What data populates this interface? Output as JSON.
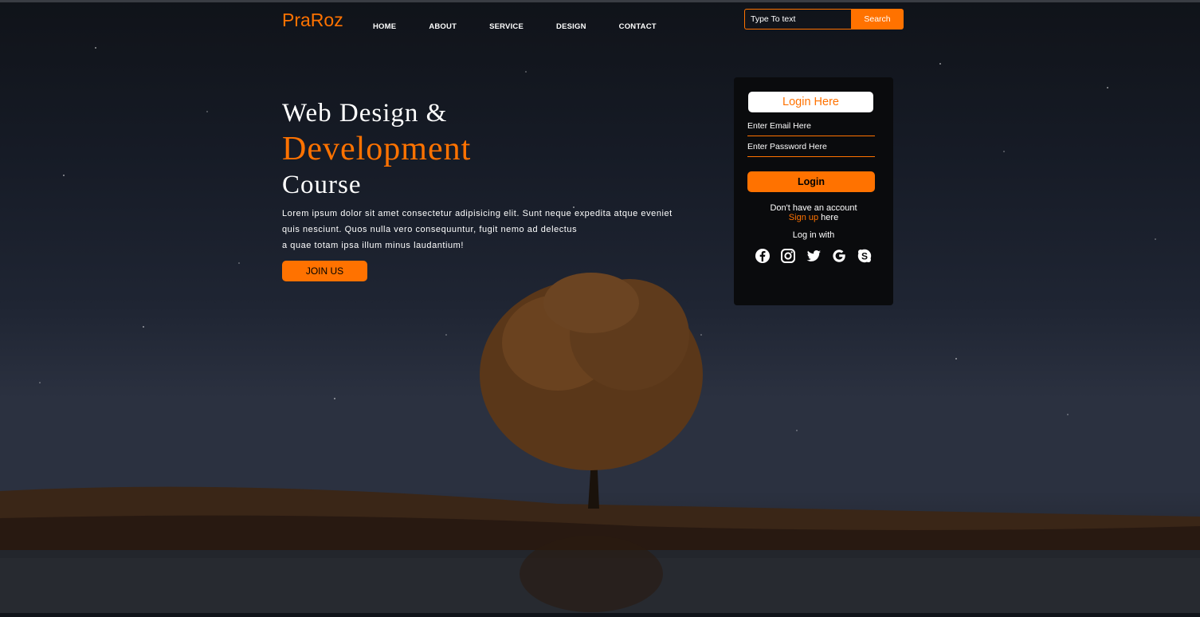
{
  "brand": {
    "logo": "PraRoz"
  },
  "nav": {
    "items": [
      "HOME",
      "ABOUT",
      "SERVICE",
      "DESIGN",
      "CONTACT"
    ]
  },
  "search": {
    "placeholder": "Type To text",
    "button_label": "Search"
  },
  "hero": {
    "line1": "Web Design &",
    "line2": "Development",
    "line3": "Course",
    "paragraph_lines": [
      "Lorem ipsum dolor sit amet consectetur adipisicing elit. Sunt neque expedita atque eveniet",
      "quis nesciunt. Quos nulla vero consequuntur, fugit nemo ad delectus",
      "a quae totam ipsa illum minus laudantium!"
    ],
    "button_label": "JOIN US"
  },
  "login": {
    "title": "Login Here",
    "email_placeholder": "Enter Email Here",
    "password_placeholder": "Enter Password Here",
    "button_label": "Login",
    "no_account": "Don't have an account",
    "signup_link": "Sign up",
    "signup_suffix": " here",
    "login_with": "Log in with",
    "social_icons": [
      "facebook-icon",
      "instagram-icon",
      "twitter-icon",
      "google-icon",
      "skype-icon"
    ]
  },
  "colors": {
    "accent": "#ff7200",
    "card": "#0a0b0d",
    "text": "#ffffff"
  }
}
